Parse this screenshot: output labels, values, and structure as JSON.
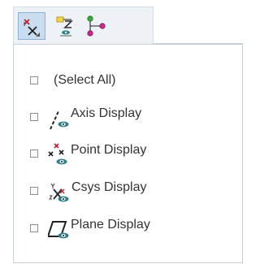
{
  "toolbar": {
    "buttons": [
      {
        "icon": "display-filter-icon",
        "active": true
      },
      {
        "icon": "layer-visibility-icon",
        "active": false
      },
      {
        "icon": "tree-node-icon",
        "active": false
      }
    ]
  },
  "filter_list": {
    "items": [
      {
        "label": "(Select All)",
        "checked": false,
        "icon": null
      },
      {
        "label": "Axis Display",
        "checked": false,
        "icon": "axis-display-icon"
      },
      {
        "label": "Point Display",
        "checked": false,
        "icon": "point-display-icon"
      },
      {
        "label": "Csys Display",
        "checked": false,
        "icon": "csys-display-icon"
      },
      {
        "label": "Plane Display",
        "checked": false,
        "icon": "plane-display-icon"
      }
    ]
  },
  "colors": {
    "accent_red": "#d2202f",
    "eye_teal": "#2f7f8a",
    "active_bg": "#c9dcf0"
  }
}
